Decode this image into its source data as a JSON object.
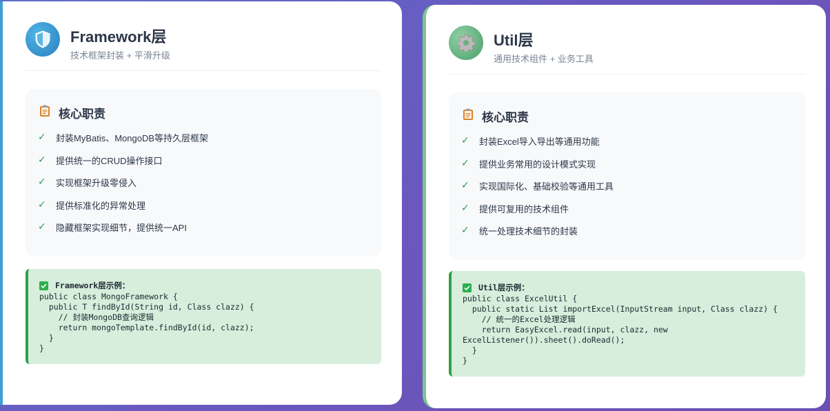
{
  "framework": {
    "title": "Framework层",
    "subtitle": "技术框架封装 + 平滑升级",
    "logo_icon": "shield-icon",
    "responsibilities_title": "核心职责",
    "responsibilities": [
      "封装MyBatis、MongoDB等持久层框架",
      "提供统一的CRUD操作接口",
      "实现框架升级零侵入",
      "提供标准化的异常处理",
      "隐藏框架实现细节，提供统一API"
    ],
    "example_title": "Framework层示例：",
    "example_code": "public class MongoFramework {\n  public T findById(String id, Class clazz) {\n    // 封装MongoDB查询逻辑\n    return mongoTemplate.findById(id, clazz);\n  }\n}",
    "accent": "#3d9fd4"
  },
  "util": {
    "title": "Util层",
    "subtitle": "通用技术组件 + 业务工具",
    "logo_icon": "gear-icon",
    "responsibilities_title": "核心职责",
    "responsibilities": [
      "封装Excel导入导出等通用功能",
      "提供业务常用的设计模式实现",
      "实现国际化、基础校验等通用工具",
      "提供可复用的技术组件",
      "统一处理技术细节的封装"
    ],
    "example_title": "Util层示例：",
    "example_code": "public class ExcelUtil {\n  public static List importExcel(InputStream input, Class clazz) {\n    // 统一的Excel处理逻辑\n    return EasyExcel.read(input, clazz, new ExcelListener()).sheet().doRead();\n  }\n}",
    "accent": "#7cc492"
  },
  "check_mark": "✓"
}
